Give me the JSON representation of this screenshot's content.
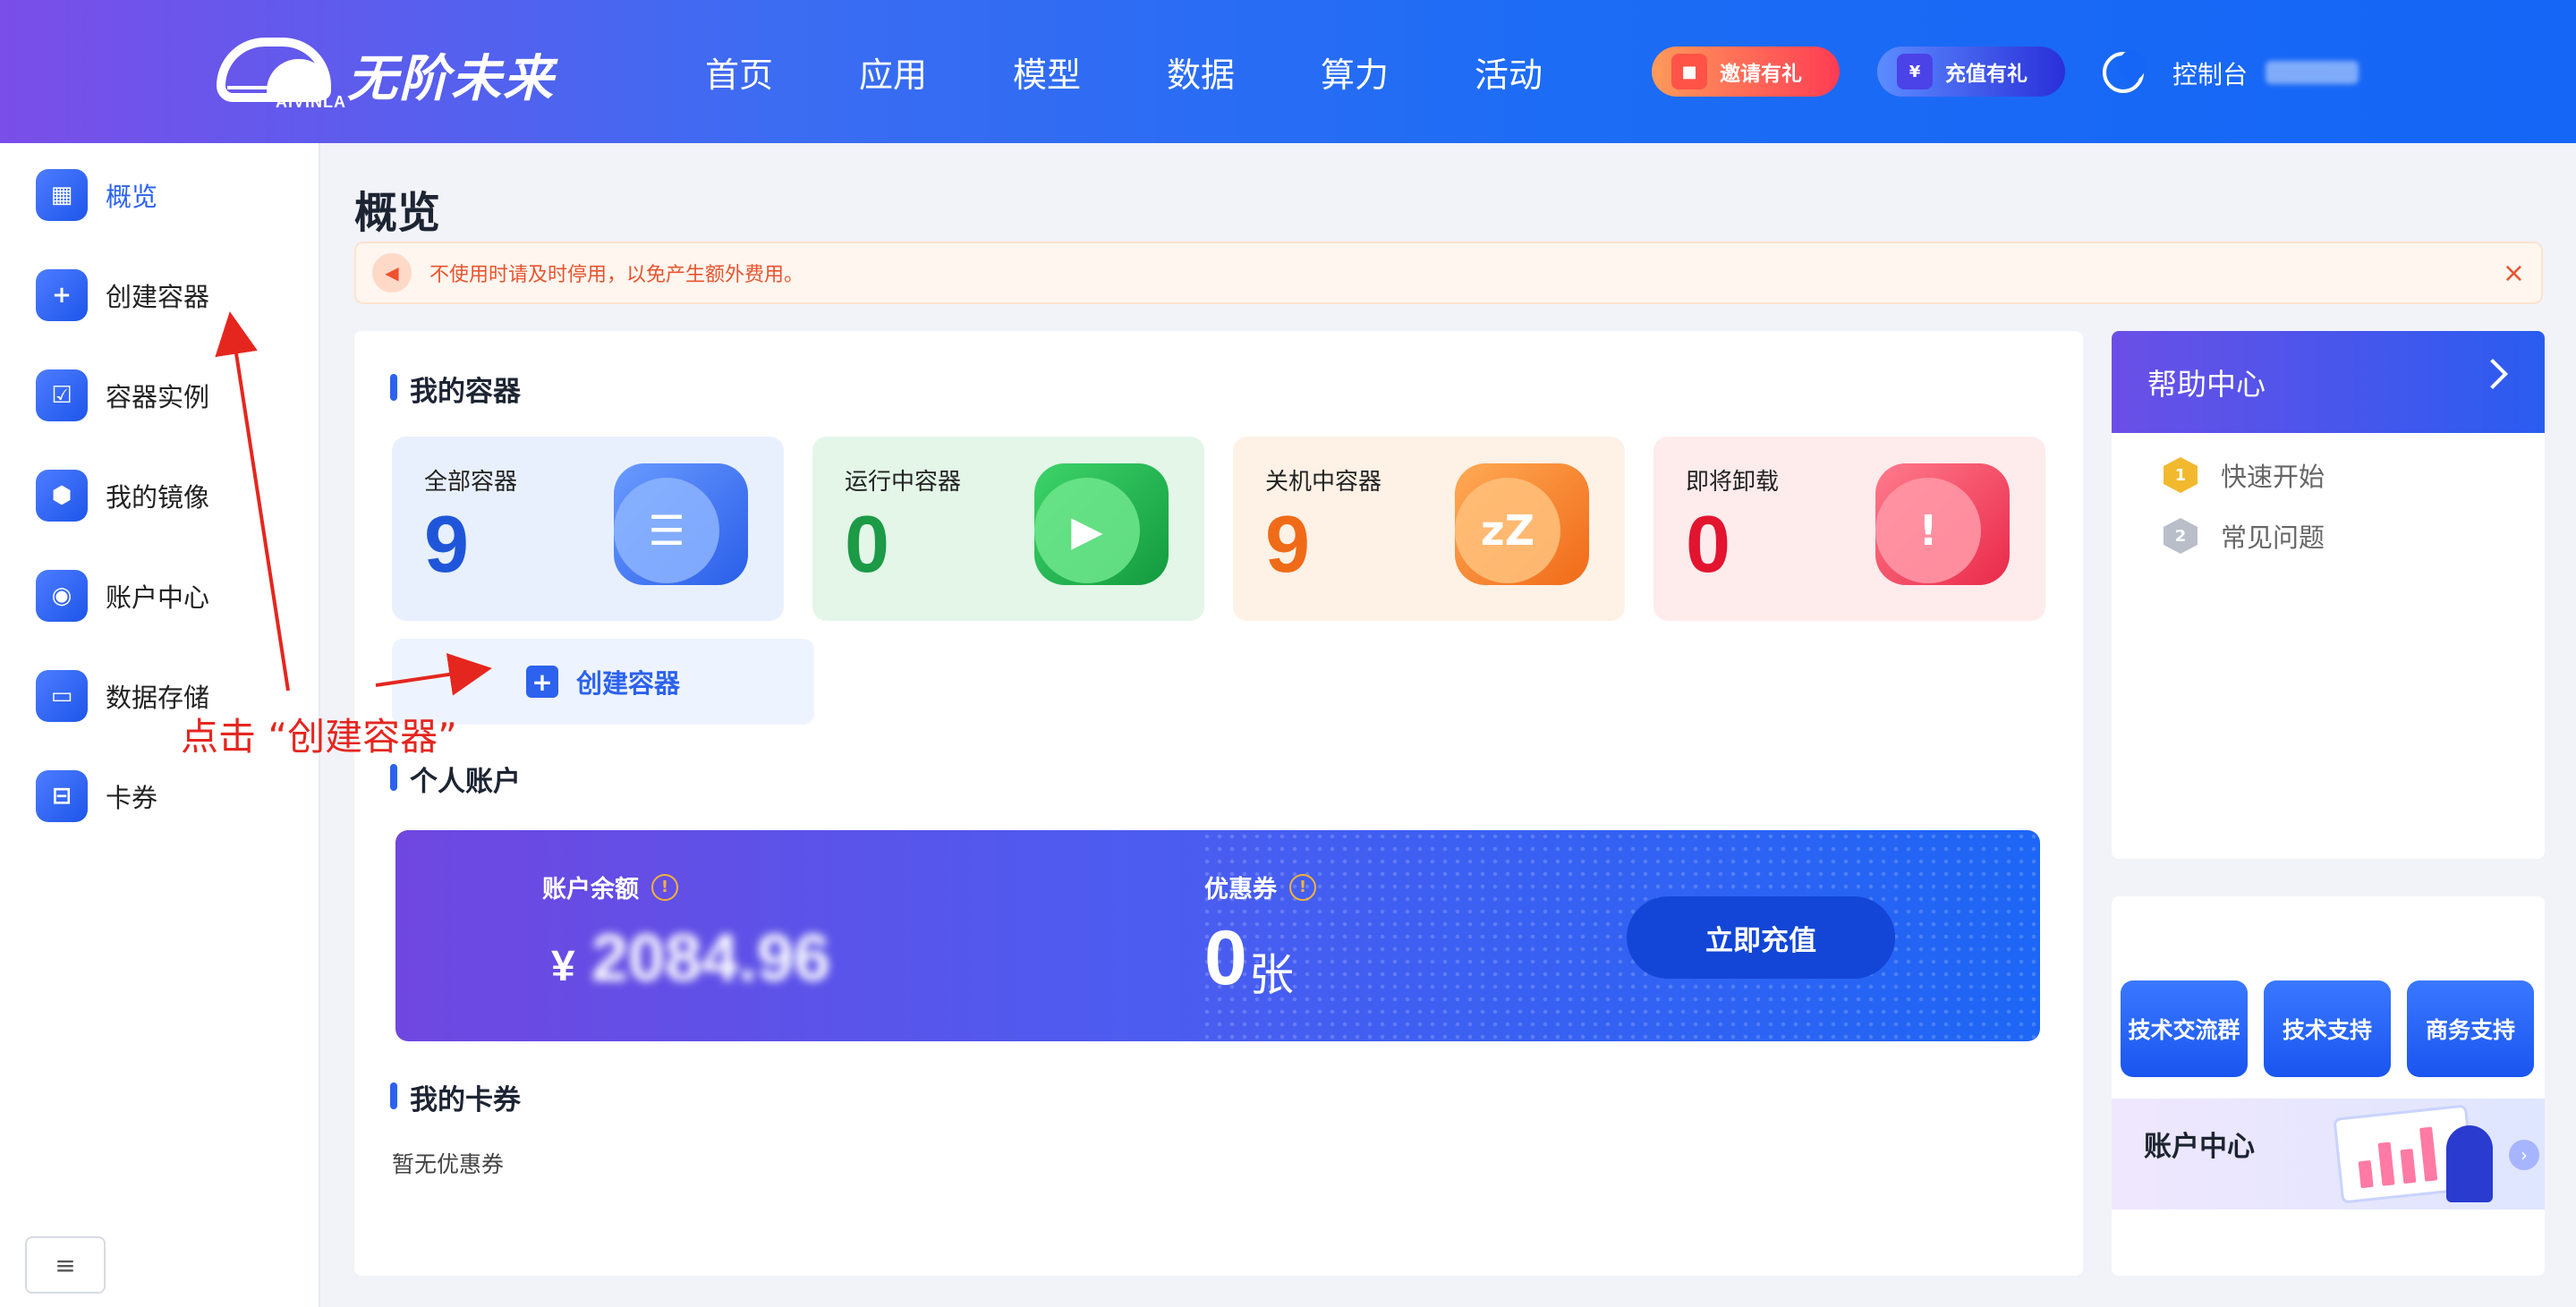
{
  "header": {
    "brand_name": "无阶未来",
    "brand_sub": "AIVINLA",
    "nav": [
      "首页",
      "应用",
      "模型",
      "数据",
      "算力",
      "活动"
    ],
    "invite_label": "邀请有礼",
    "recharge_label": "充值有礼",
    "console_label": "控制台",
    "theme_icon": "theme-toggle-icon"
  },
  "sidebar": {
    "items": [
      {
        "label": "概览",
        "icon": "overview-icon",
        "active": true
      },
      {
        "label": "创建容器",
        "icon": "plus-box-icon"
      },
      {
        "label": "容器实例",
        "icon": "instances-icon"
      },
      {
        "label": "我的镜像",
        "icon": "images-icon"
      },
      {
        "label": "账户中心",
        "icon": "account-icon"
      },
      {
        "label": "数据存储",
        "icon": "storage-icon"
      },
      {
        "label": "卡券",
        "icon": "coupon-icon"
      }
    ],
    "collapse_icon": "menu-collapse-icon"
  },
  "main": {
    "title": "概览",
    "notice": "不使用时请及时停用，以免产生额外费用。",
    "my_containers": {
      "title": "我的容器",
      "stats": [
        {
          "label": "全部容器",
          "value": "9"
        },
        {
          "label": "运行中容器",
          "value": "0"
        },
        {
          "label": "关机中容器",
          "value": "9"
        },
        {
          "label": "即将卸载",
          "value": "0"
        }
      ],
      "create_button": "创建容器"
    },
    "personal_account": {
      "title": "个人账户",
      "balance_label": "账户余额",
      "currency": "¥",
      "balance_value": "2084.96",
      "coupon_label": "优惠券",
      "coupon_count": "0",
      "coupon_unit": "张",
      "recharge_button": "立即充值"
    },
    "my_coupons": {
      "title": "我的卡券",
      "empty_text": "暂无优惠券"
    }
  },
  "help_center": {
    "title": "帮助中心",
    "items": [
      "快速开始",
      "常见问题"
    ]
  },
  "support": {
    "buttons": [
      "技术交流群",
      "技术支持",
      "商务支持"
    ],
    "account_banner": "账户中心"
  },
  "annotation": {
    "text": "点击 “创建容器”",
    "color": "#e5261f"
  }
}
